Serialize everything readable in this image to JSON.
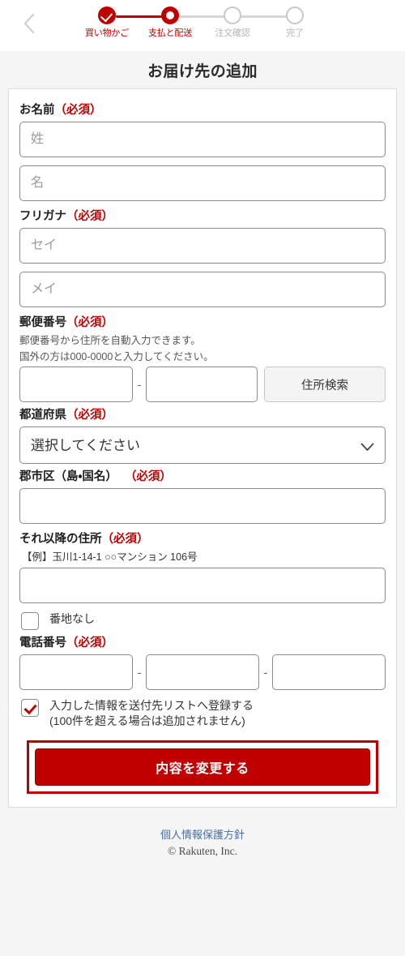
{
  "header": {
    "back_icon": "chevron-left-icon",
    "steps": [
      {
        "label": "買い物かご",
        "state": "complete"
      },
      {
        "label": "支払と配送",
        "state": "current"
      },
      {
        "label": "注文確認",
        "state": "pending"
      },
      {
        "label": "完了",
        "state": "pending"
      }
    ]
  },
  "page_title": "お届け先の追加",
  "form": {
    "name": {
      "label": "お名前",
      "required": "（必須）",
      "last_name_placeholder": "姓",
      "last_name_value": "",
      "first_name_placeholder": "名",
      "first_name_value": ""
    },
    "furigana": {
      "label": "フリガナ",
      "required": "（必須）",
      "sei_placeholder": "セイ",
      "sei_value": "",
      "mei_placeholder": "メイ",
      "mei_value": ""
    },
    "postal": {
      "label": "郵便番号",
      "required": "（必須）",
      "hint_line1": "郵便番号から住所を自動入力できます。",
      "hint_line2": "国外の方は000-0000と入力してください。",
      "zip1_value": "",
      "zip2_value": "",
      "separator": "-",
      "search_button": "住所検索"
    },
    "prefecture": {
      "label": "都道府県",
      "required": "（必須）",
      "selected": "選択してください",
      "chevron_icon": "chevron-down-icon"
    },
    "city": {
      "label": "郡市区（島・国名）",
      "required": "（必須）",
      "value": ""
    },
    "address_rest": {
      "label": "それ以降の住所",
      "required": "（必須）",
      "example": "【例】玉川1-14-1 ○○マンション 106号",
      "value": ""
    },
    "no_block_number": {
      "label": "番地なし",
      "checked": false
    },
    "phone": {
      "label": "電話番号",
      "required": "（必須）",
      "part1_value": "",
      "part2_value": "",
      "part3_value": "",
      "separator": "-"
    },
    "register_list": {
      "line1": "入力した情報を送付先リストへ登録する",
      "line2": "(100件を超える場合は追加されません)",
      "checked": true
    },
    "submit_label": "内容を変更する"
  },
  "footer": {
    "privacy_link": "個人情報保護方針",
    "copyright": "© Rakuten, Inc."
  },
  "colors": {
    "brand_red": "#c00000",
    "step_red": "#bf0000",
    "page_bg": "#f5f5f5",
    "link_blue": "#4a6f9e"
  }
}
